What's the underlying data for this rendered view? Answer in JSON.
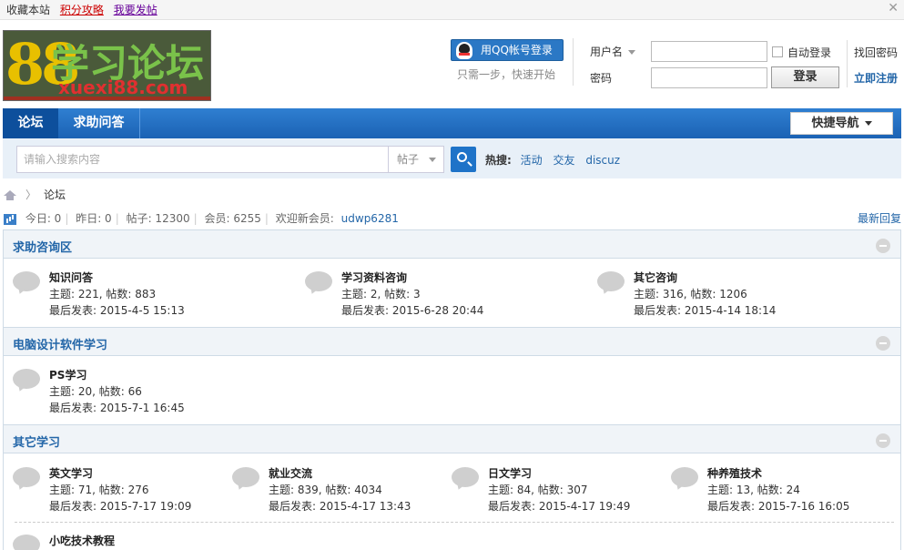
{
  "topbar": {
    "links": [
      "收藏本站",
      "积分攻略",
      "我要发帖"
    ]
  },
  "header": {
    "logo_text_cn": "学习论坛",
    "logo_text_en": "xuexi88.com",
    "logo_number": "88",
    "qq_login": "用QQ帐号登录",
    "qq_tip": "只需一步，快速开始",
    "username_label": "用户名",
    "password_label": "密码",
    "auto_login": "自动登录",
    "login_button": "登录",
    "find_password": "找回密码",
    "register": "立即注册"
  },
  "nav": {
    "tabs": [
      "论坛",
      "求助问答"
    ],
    "quick_nav": "快捷导航"
  },
  "search": {
    "placeholder": "请输入搜索内容",
    "type": "帖子",
    "hot_label": "热搜:",
    "hot": [
      "活动",
      "交友",
      "discuz"
    ]
  },
  "breadcrumb": {
    "current": "论坛"
  },
  "stats": {
    "today": "今日: 0",
    "yesterday": "昨日: 0",
    "posts": "帖子: 12300",
    "members": "会员: 6255",
    "welcome": "欢迎新会员:",
    "new_member": "udwp6281",
    "latest_reply": "最新回复"
  },
  "categories": [
    {
      "title": "求助咨询区",
      "forums": [
        {
          "name": "知识问答",
          "meta": "主题: 221, 帖数: 883",
          "last": "最后发表: 2015-4-5 15:13"
        },
        {
          "name": "学习资料咨询",
          "meta": "主题: 2, 帖数: 3",
          "last": "最后发表: 2015-6-28 20:44"
        },
        {
          "name": "其它咨询",
          "meta": "主题: 316, 帖数: 1206",
          "last": "最后发表: 2015-4-14 18:14"
        }
      ]
    },
    {
      "title": "电脑设计软件学习",
      "forums": [
        {
          "name": "PS学习",
          "meta": "主题: 20, 帖数: 66",
          "last": "最后发表: 2015-7-1 16:45"
        }
      ]
    },
    {
      "title": "其它学习",
      "forums": [
        {
          "name": "英文学习",
          "meta": "主题: 71, 帖数: 276",
          "last": "最后发表: 2015-7-17 19:09"
        },
        {
          "name": "就业交流",
          "meta": "主题: 839, 帖数: 4034",
          "last": "最后发表: 2015-4-17 13:43"
        },
        {
          "name": "日文学习",
          "meta": "主题: 84, 帖数: 307",
          "last": "最后发表: 2015-4-17 19:49"
        },
        {
          "name": "种养殖技术",
          "meta": "主题: 13, 帖数: 24",
          "last": "最后发表: 2015-7-16 16:05"
        },
        {
          "name": "小吃技术教程"
        }
      ]
    }
  ]
}
